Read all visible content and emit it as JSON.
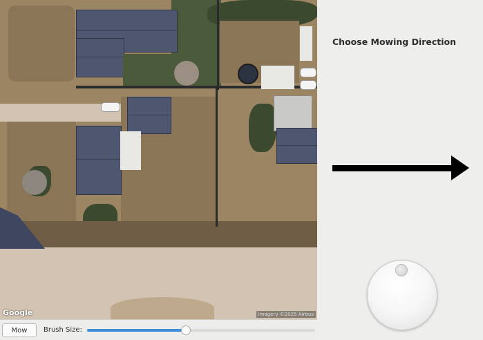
{
  "map": {
    "provider_label": "Google",
    "imagery_credit": "Imagery ©2025 Airbus"
  },
  "toolbar": {
    "mow_label": "Mow",
    "brush_label": "Brush Size:",
    "brush_size_fraction": 0.43
  },
  "panel": {
    "title": "Choose Mowing Direction",
    "direction": "east",
    "arrow_color": "#000000"
  },
  "icons": {
    "arrow": "arrow-right-icon",
    "dial": "direction-dial-icon"
  }
}
